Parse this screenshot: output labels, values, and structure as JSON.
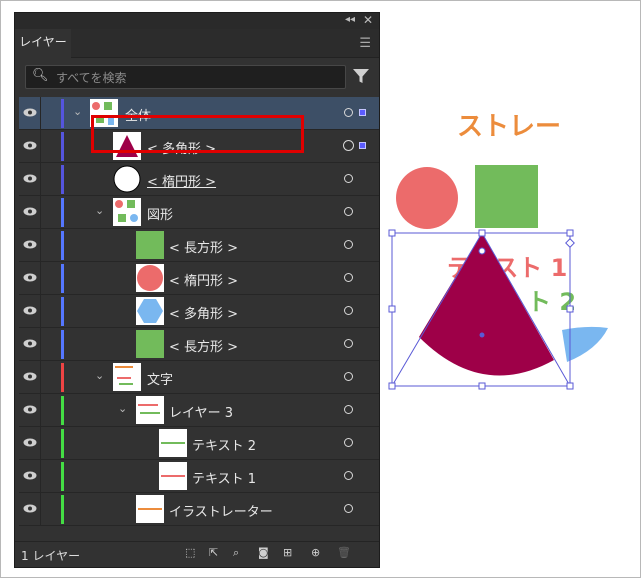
{
  "panel": {
    "tab_label": "レイヤー",
    "search_placeholder": "すべてを検索",
    "footer_count": "1 レイヤー"
  },
  "layers": [
    {
      "label": "全体",
      "level": 0,
      "expanded": true,
      "color": "#5555dd",
      "selected": true
    },
    {
      "label": "< 多角形 >",
      "level": 1,
      "color": "#5555dd",
      "targeted": true
    },
    {
      "label": "< 楕円形 >",
      "level": 1,
      "color": "#5555dd"
    },
    {
      "label": "図形",
      "level": 1,
      "expanded": true,
      "color": "#5577ff"
    },
    {
      "label": "< 長方形 >",
      "level": 2,
      "color": "#5577ff"
    },
    {
      "label": "< 楕円形 >",
      "level": 2,
      "color": "#5577ff"
    },
    {
      "label": "< 多角形 >",
      "level": 2,
      "color": "#5577ff"
    },
    {
      "label": "< 長方形 >",
      "level": 2,
      "color": "#5577ff"
    },
    {
      "label": "文字",
      "level": 1,
      "expanded": true,
      "color": "#ee4444"
    },
    {
      "label": "レイヤー 3",
      "level": 2,
      "expanded": true,
      "color": "#44dd44"
    },
    {
      "label": "テキスト 2",
      "level": 3,
      "color": "#44dd44"
    },
    {
      "label": "テキスト 1",
      "level": 3,
      "color": "#44dd44"
    },
    {
      "label": "イラストレーター",
      "level": 2,
      "color": "#44dd44"
    }
  ],
  "canvas": {
    "top_text": "ストレー",
    "text1": "テキスト 1",
    "text2": "ト 2"
  },
  "colors": {
    "panel_bg": "#323232",
    "selection": "#3d4f66",
    "highlight": "#e00000",
    "triangle": "#9e0048",
    "red_circle": "#ec6b6b",
    "green_square": "#72bb5b",
    "blue_shape": "#7ab7f0"
  }
}
